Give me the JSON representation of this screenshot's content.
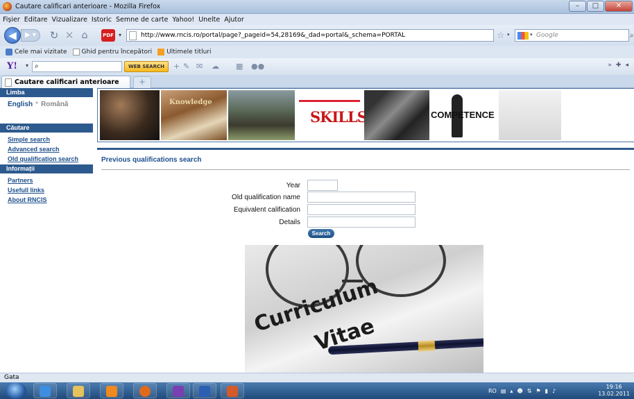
{
  "window": {
    "title": "Cautare calificari anterioare - Mozilla Firefox",
    "minimize": "–",
    "maximize": "□",
    "close": "✕"
  },
  "menu": [
    "Fișier",
    "Editare",
    "Vizualizare",
    "Istoric",
    "Semne de carte",
    "Yahoo!",
    "Unelte",
    "Ajutor"
  ],
  "navigation": {
    "url": "http://www.rncis.ro/portal/page?_pageid=54,28169&_dad=portal&_schema=PORTAL",
    "search_placeholder": "Google",
    "pdf_label": "PDF"
  },
  "bookmarks": [
    {
      "label": "Cele mai vizitate",
      "icon": "most-visited-icon"
    },
    {
      "label": "Ghid pentru începători",
      "icon": "page-icon"
    },
    {
      "label": "Ultimele titluri",
      "icon": "rss-icon"
    }
  ],
  "yahoo_toolbar": {
    "logo": "Y!",
    "search_button": "WEB SEARCH"
  },
  "tabs": [
    {
      "label": "Cautare calificari anterioare",
      "active": true
    }
  ],
  "sidebar": {
    "language_header": "Limba",
    "languages": {
      "english": "English",
      "separator": "*",
      "romanian": "Română"
    },
    "search_header": "Căutare",
    "search_links": [
      "Simple search",
      "Advanced search",
      "Old qualification search"
    ],
    "info_header": "Informații",
    "info_links": [
      "Partners",
      "Usefull links",
      "About RNCIS"
    ]
  },
  "banner": {
    "knowledge_text": "Knowledge",
    "skills_text": "SKILLS",
    "competence_text": "COMPETENCE"
  },
  "main": {
    "section_title": "Previous qualifications search",
    "form": {
      "year_label": "Year",
      "year_value": "",
      "old_name_label": "Old qualification name",
      "old_name_value": "",
      "equivalent_label": "Equivalent calification",
      "equivalent_value": "",
      "details_label": "Details",
      "details_value": "",
      "search_button": "Search"
    },
    "image_text_line1": "Curriculum",
    "image_text_line2": "Vitae"
  },
  "status": {
    "text": "Gata"
  },
  "taskbar": {
    "language": "RO",
    "time": "19:16",
    "date": "13.02.2011"
  },
  "colors": {
    "sidebar_header_bg": "#2d5a8e",
    "link": "#1d4f8c",
    "accent": "#2d5a8e"
  }
}
